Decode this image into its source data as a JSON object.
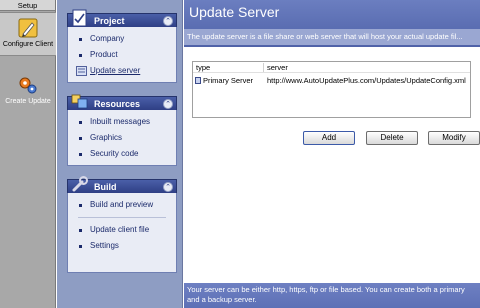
{
  "rail": {
    "header": "Setup",
    "items": [
      {
        "label": "Configure Client",
        "icon": "pencil-wrench-icon",
        "active": true
      },
      {
        "label": "Create Update",
        "icon": "gears-icon",
        "active": false
      }
    ]
  },
  "nav": {
    "groups": [
      {
        "title": "Project",
        "icon": "project-document-icon",
        "items": [
          {
            "label": "Company"
          },
          {
            "label": "Product"
          },
          {
            "label": "Update server",
            "selected": true
          }
        ]
      },
      {
        "title": "Resources",
        "icon": "resources-icon",
        "items": [
          {
            "label": "Inbuilt messages"
          },
          {
            "label": "Graphics"
          },
          {
            "label": "Security code"
          }
        ]
      },
      {
        "title": "Build",
        "icon": "wrench-icon",
        "items": [
          {
            "label": "Build and preview"
          },
          {
            "label": "Update client file"
          },
          {
            "label": "Settings"
          }
        ]
      }
    ]
  },
  "main": {
    "title": "Update Server",
    "description": "The update server is a file share or web server that will host your actual update fil...",
    "table": {
      "columns": [
        "type",
        "server"
      ],
      "rows": [
        {
          "type": "Primary Server",
          "server": "http://www.AutoUpdatePlus.com/Updates/UpdateConfig.xml"
        }
      ]
    },
    "buttons": {
      "add": "Add",
      "delete": "Delete",
      "modify": "Modify"
    },
    "footer": "Your server can be either http, https, ftp or file based. You can create both a primary and a backup server."
  },
  "colors": {
    "header_blue": "#5a6db4",
    "nav_bg": "#8e9dc3",
    "rail_bg": "#a8a8a8"
  }
}
